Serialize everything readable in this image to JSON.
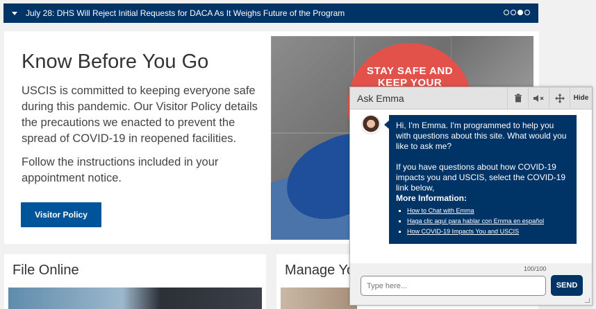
{
  "alert": {
    "text": "July 28: DHS Will Reject Initial Requests for DACA As It Weighs Future of the Program",
    "slides_total": 4,
    "active_slide": 3
  },
  "hero": {
    "title": "Know Before You Go",
    "paragraph1": "USCIS is committed to keeping everyone safe during this pandemic. Our Visitor Policy details the precautions we enacted to prevent the spread of COVID-19 in reopened facilities.",
    "paragraph2": "Follow the instructions included in your appointment notice.",
    "button_label": "Visitor Policy",
    "image_sign_text": "STAY SAFE AND KEEP YOUR"
  },
  "cards": [
    {
      "title": "File Online"
    },
    {
      "title": "Manage Yo"
    }
  ],
  "chat": {
    "title": "Ask Emma",
    "buttons": {
      "delete_icon": "trash-icon",
      "mute_icon": "mute-icon",
      "move_icon": "move-icon",
      "hide_label": "Hide"
    },
    "message_intro": "Hi, I'm Emma. I'm programmed to help you with questions about this site. What would you like to ask me?",
    "message_covid": "If you have questions about how COVID-19 impacts you and USCIS, select the COVID-19 link below,",
    "more_info_label": "More Information:",
    "links": [
      "How to Chat with Emma",
      "Haga clic aquí para hablar con Emma en español",
      "How COVID-19 Impacts You and USCIS"
    ],
    "counter": "100/100",
    "input_placeholder": "Type here...",
    "send_label": "SEND"
  },
  "colors": {
    "navy": "#003366",
    "button_blue": "#00549a"
  }
}
